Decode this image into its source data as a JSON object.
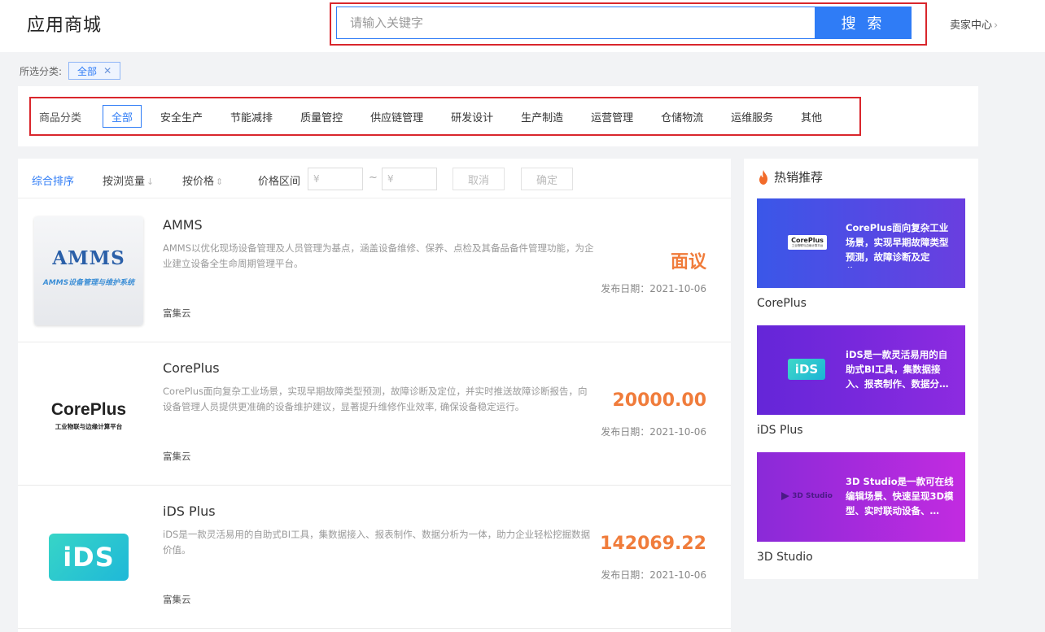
{
  "header": {
    "title": "应用商城",
    "search_placeholder": "请输入关键字",
    "search_button": "搜 索",
    "seller_center": "卖家中心"
  },
  "selected": {
    "label": "所选分类:",
    "tag": "全部"
  },
  "categories": {
    "label": "商品分类",
    "items": [
      "全部",
      "安全生产",
      "节能减排",
      "质量管控",
      "供应链管理",
      "研发设计",
      "生产制造",
      "运营管理",
      "仓储物流",
      "运维服务",
      "其他"
    ],
    "active_index": 0
  },
  "sort": {
    "default": "综合排序",
    "by_views": "按浏览量",
    "by_price": "按价格",
    "price_range": "价格区间",
    "currency": "¥",
    "range_sep": "~",
    "cancel": "取消",
    "confirm": "确定"
  },
  "products": [
    {
      "name": "AMMS",
      "desc": "AMMS以优化现场设备管理及人员管理为基点，涵盖设备维修、保养、点检及其备品备件管理功能，为企业建立设备全生命周期管理平台。",
      "vendor": "富集云",
      "price": "面议",
      "date": "发布日期：2021-10-06",
      "logo_text": "AMMS",
      "logo_subtext": "AMMS设备管理与维护系统"
    },
    {
      "name": "CorePlus",
      "desc": "CorePlus面向复杂工业场景，实现早期故障类型预测，故障诊断及定位，并实时推送故障诊断报告，向设备管理人员提供更准确的设备维护建议，显著提升维修作业效率, 确保设备稳定运行。",
      "vendor": "富集云",
      "price": "20000.00",
      "date": "发布日期：2021-10-06",
      "logo_text": "CorePlus",
      "logo_subtext": "工业物联与边缘计算平台"
    },
    {
      "name": "iDS Plus",
      "desc": "iDS是一款灵活易用的自助式BI工具，集数据接入、报表制作、数据分析为一体，助力企业轻松挖掘数据价值。",
      "vendor": "富集云",
      "price": "142069.22",
      "date": "发布日期：2021-10-06",
      "logo_text": "iDS"
    }
  ],
  "hot": {
    "title": "热销推荐",
    "items": [
      {
        "name": "CorePlus",
        "desc": "CorePlus面向复杂工业场景，实现早期故障类型预测，故障诊断及定位，…",
        "thumb": "CorePlus",
        "thumb_sub": "工业物联与边缘计算平台",
        "color1": "#3a57e8",
        "color2": "#6a3ee0"
      },
      {
        "name": "iDS Plus",
        "desc": "iDS是一款灵活易用的自助式BI工具，集数据接入、报表制作、数据分…",
        "thumb": "iDS",
        "color1": "#6426d8",
        "color2": "#8d2be0"
      },
      {
        "name": "3D Studio",
        "desc": "3D Studio是一款可在线编辑场景、快速呈现3D模型、实时联动设备、…",
        "thumb": "3D Studio",
        "color1": "#8a2ad8",
        "color2": "#c22be0"
      }
    ]
  },
  "colors": {
    "accent": "#2f7cf6",
    "price": "#f07c3b",
    "highlight_box": "#d9262c"
  }
}
